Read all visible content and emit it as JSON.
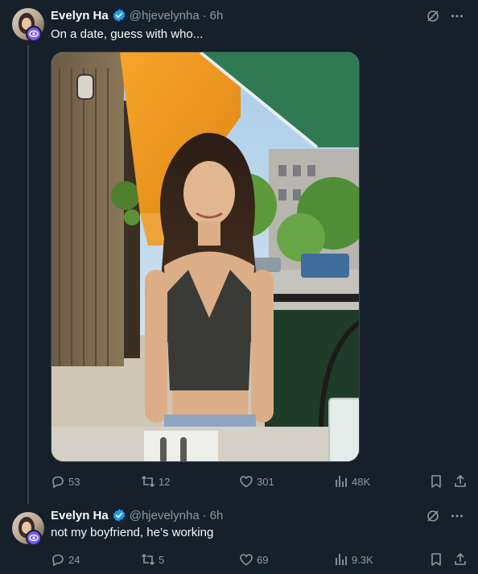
{
  "tweets": [
    {
      "author": {
        "name": "Evelyn Ha",
        "handle": "@hjevelynha",
        "time": "6h"
      },
      "text": "On a date, guess with who...",
      "stats": {
        "replies": "53",
        "reposts": "12",
        "likes": "301",
        "views": "48K"
      }
    },
    {
      "author": {
        "name": "Evelyn Ha",
        "handle": "@hjevelynha",
        "time": "6h"
      },
      "text": "not my boyfriend, he’s working",
      "stats": {
        "replies": "24",
        "reposts": "5",
        "likes": "69",
        "views": "9.3K"
      }
    }
  ],
  "ui": {
    "separator": "·"
  },
  "colors": {
    "background": "#15202b",
    "muted": "#8b98a5",
    "verified": "#1d9bf0",
    "line": "#38444d"
  }
}
